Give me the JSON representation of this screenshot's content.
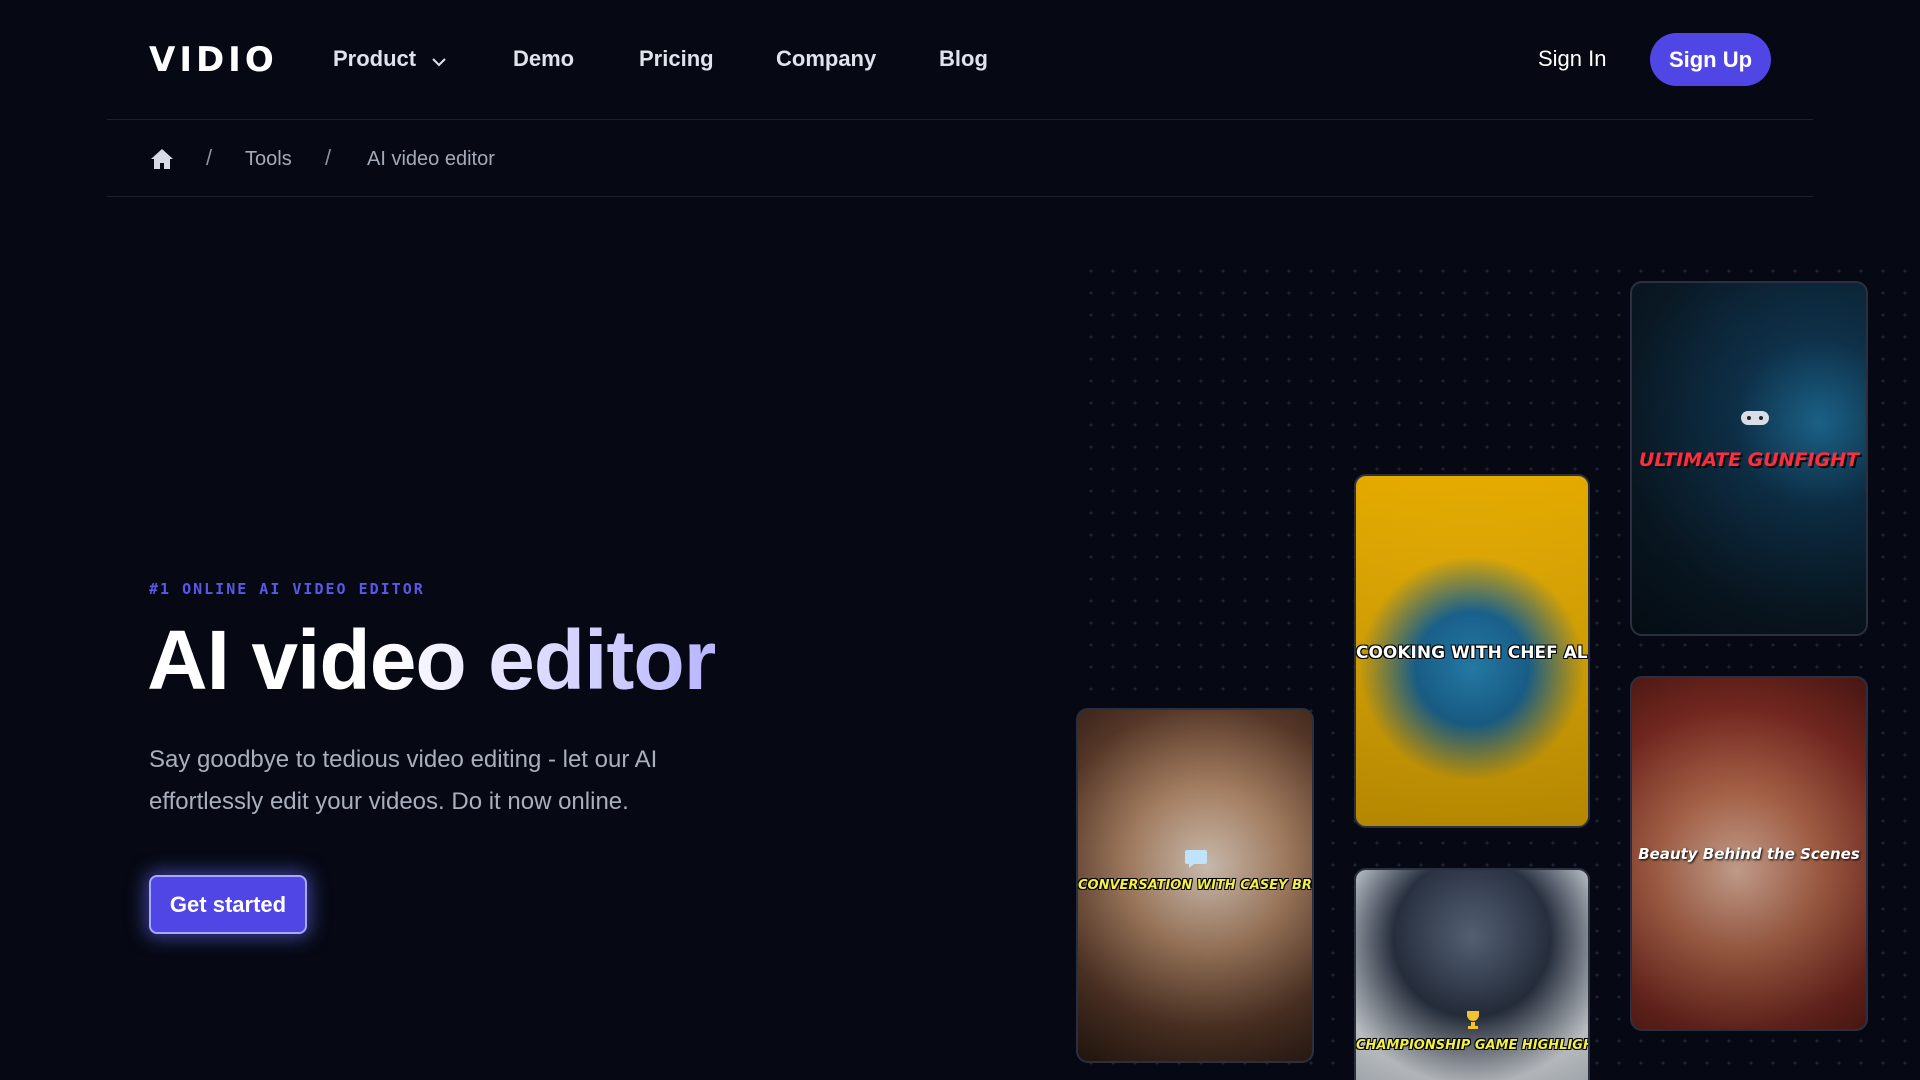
{
  "brand": {
    "logo": "VIDIO",
    "accent": "#4f46e5"
  },
  "nav": {
    "items": [
      {
        "label": "Product",
        "has_dropdown": true
      },
      {
        "label": "Demo"
      },
      {
        "label": "Pricing"
      },
      {
        "label": "Company"
      },
      {
        "label": "Blog"
      }
    ],
    "sign_in": "Sign In",
    "sign_up": "Sign Up"
  },
  "breadcrumb": {
    "home_icon": "home-icon",
    "separator": "/",
    "items": [
      "Tools",
      "AI video editor"
    ]
  },
  "hero": {
    "eyebrow": "#1 ONLINE AI VIDEO EDITOR",
    "title": "AI video editor",
    "subtitle": "Say goodbye to tedious video editing - let our AI effortlessly edit your videos. Do it now online.",
    "cta": "Get started"
  },
  "gallery": {
    "cards": [
      {
        "caption": "ULTIMATE GUNFIGHT"
      },
      {
        "caption": "COOKING WITH CHEF ALEX"
      },
      {
        "caption": "Beauty Behind the Scenes"
      },
      {
        "caption": "CONVERSATION WITH CASEY BROWN"
      },
      {
        "caption": "CHAMPIONSHIP GAME HIGHLIGHTS"
      }
    ]
  }
}
